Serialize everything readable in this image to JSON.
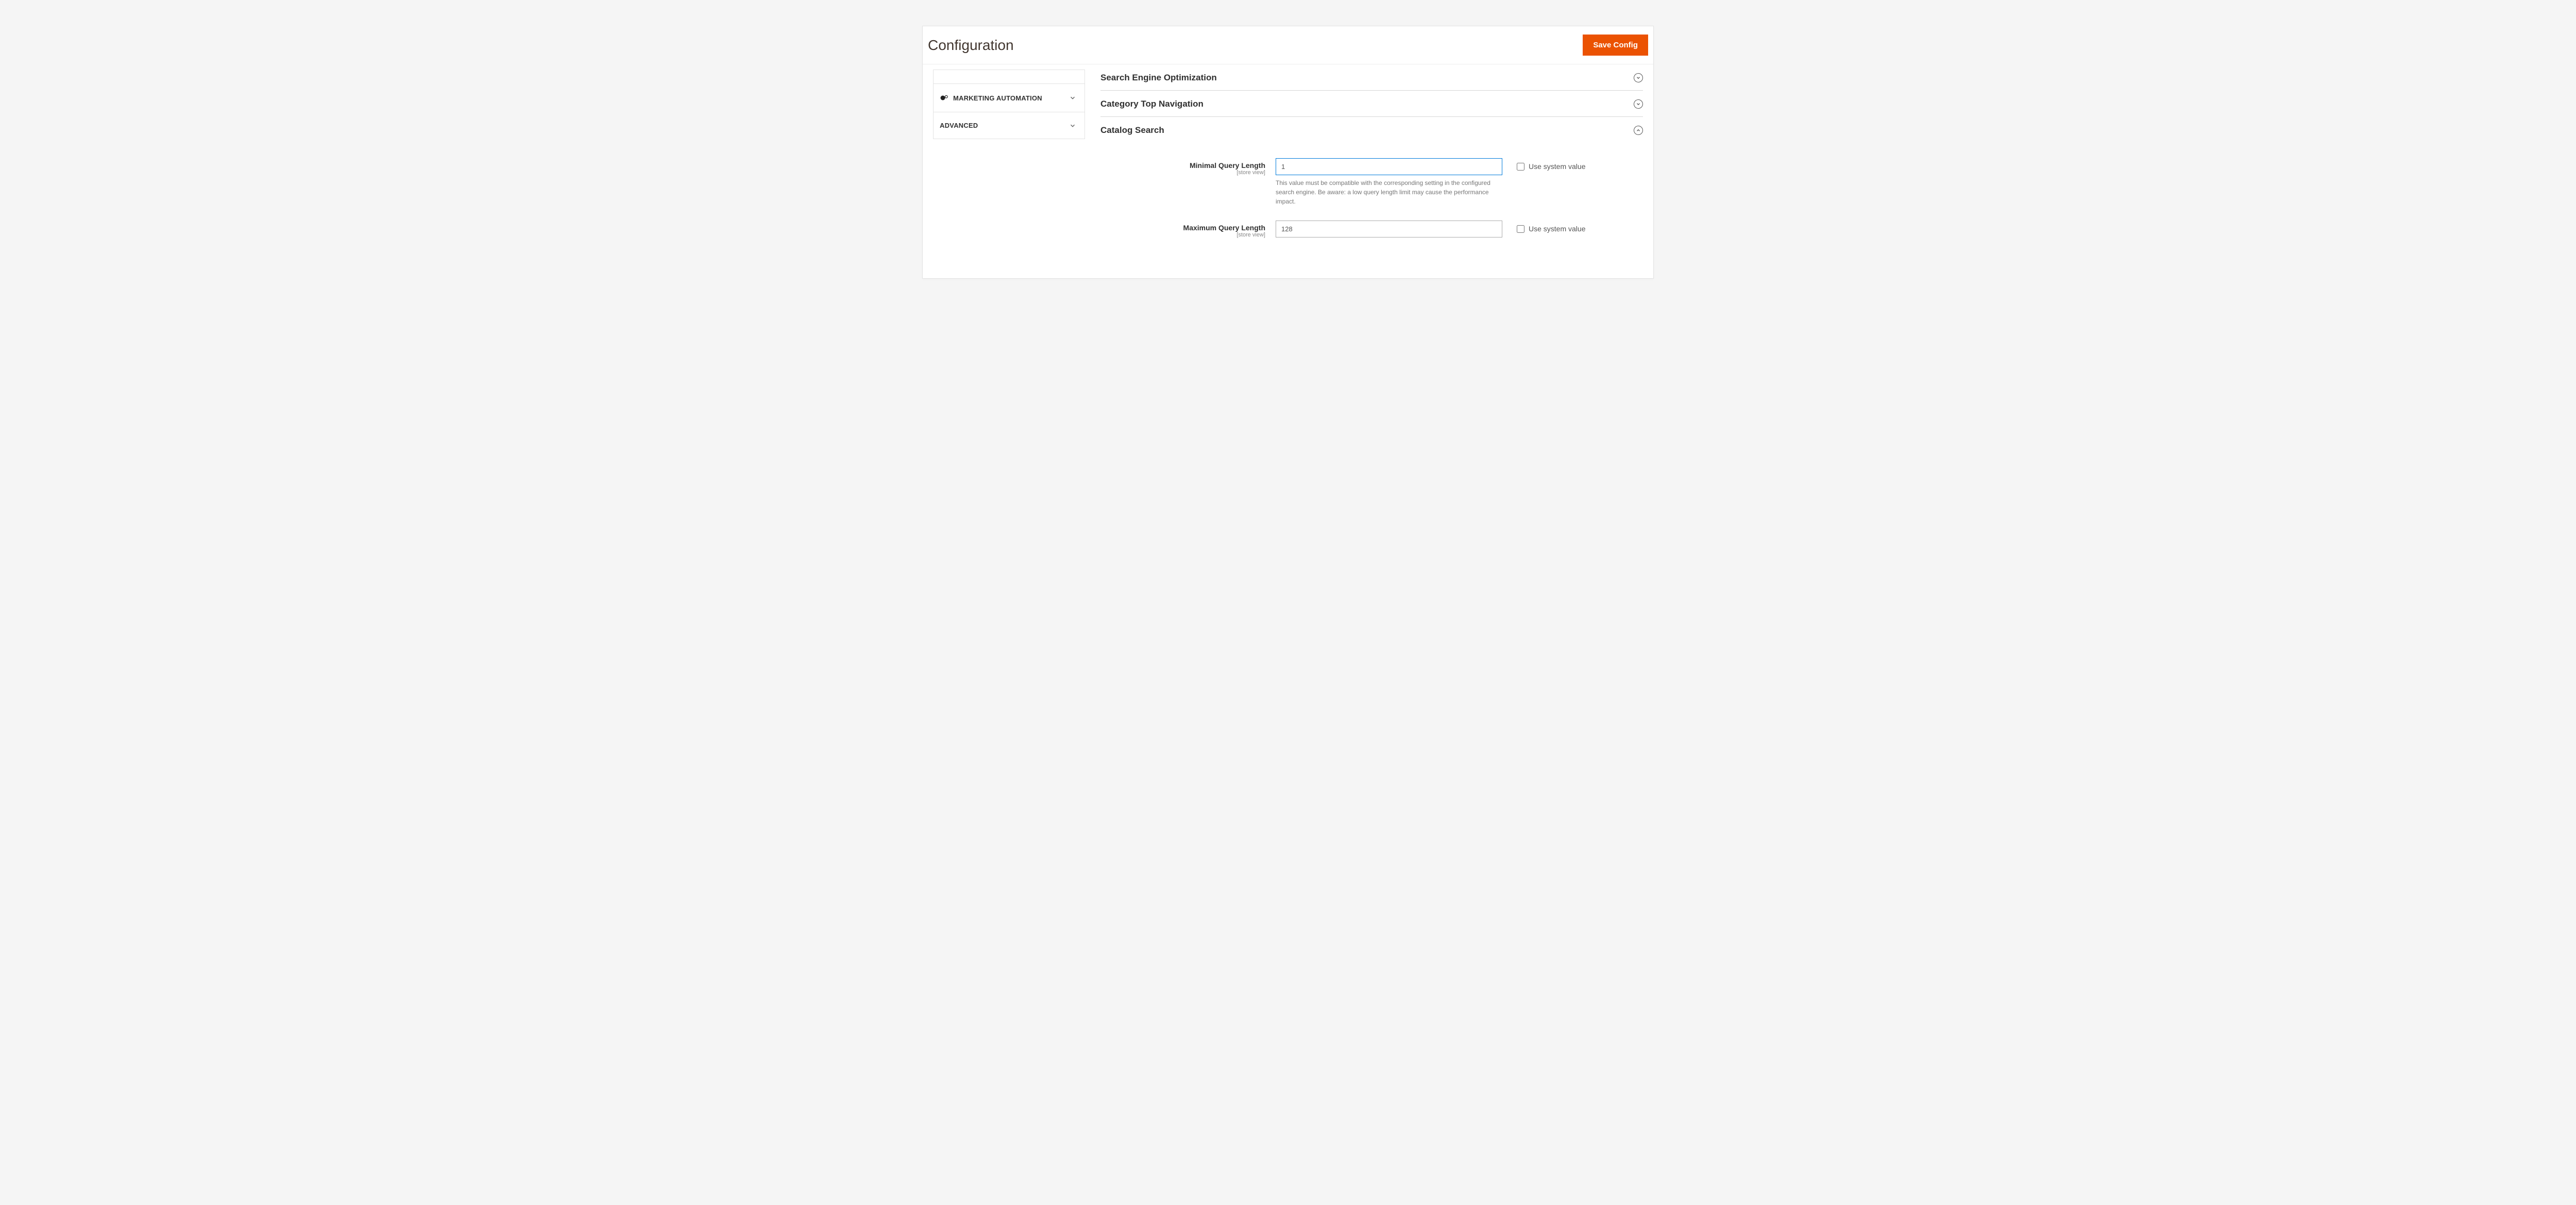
{
  "header": {
    "title": "Configuration",
    "save_label": "Save Config"
  },
  "sidebar": {
    "items": [
      {
        "label": "Marketing Automation",
        "has_icon": true
      },
      {
        "label": "Advanced",
        "has_icon": false
      }
    ]
  },
  "sections": {
    "seo": {
      "title": "Search Engine Optimization"
    },
    "nav": {
      "title": "Category Top Navigation"
    },
    "search": {
      "title": "Catalog Search"
    }
  },
  "fields": {
    "min_query": {
      "label": "Minimal Query Length",
      "scope": "[store view]",
      "value": "1",
      "help": "This value must be compatible with the corresponding setting in the configured search engine. Be aware: a low query length limit may cause the performance impact.",
      "use_system_label": "Use system value"
    },
    "max_query": {
      "label": "Maximum Query Length",
      "scope": "[store view]",
      "value": "128",
      "use_system_label": "Use system value"
    }
  }
}
